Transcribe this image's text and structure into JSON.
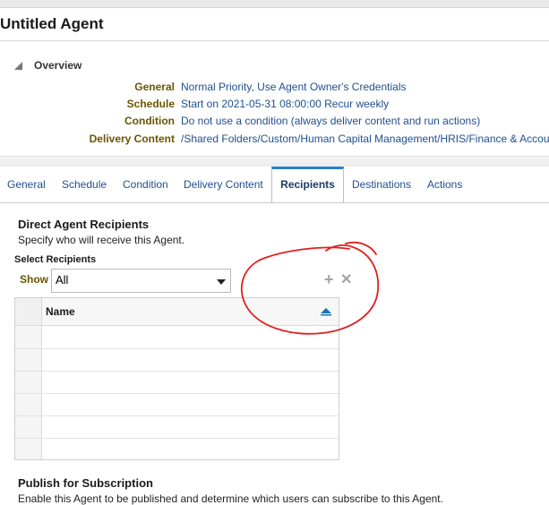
{
  "agent": {
    "title": "Untitled Agent"
  },
  "overview": {
    "heading": "Overview",
    "rows": [
      {
        "label": "General",
        "value": "Normal Priority, Use Agent Owner's Credentials"
      },
      {
        "label": "Schedule",
        "value": "Start on 2021-05-31 08:00:00 Recur weekly"
      },
      {
        "label": "Condition",
        "value": "Do not use a condition (always deliver content and run actions)"
      },
      {
        "label": "Delivery Content",
        "value": "/Shared Folders/Custom/Human Capital Management/HRIS/Finance & Accou"
      }
    ]
  },
  "tabs": [
    {
      "label": "General"
    },
    {
      "label": "Schedule"
    },
    {
      "label": "Condition"
    },
    {
      "label": "Delivery Content"
    },
    {
      "label": "Recipients"
    },
    {
      "label": "Destinations"
    },
    {
      "label": "Actions"
    }
  ],
  "recipients": {
    "title": "Direct Agent Recipients",
    "description": "Specify who will receive this Agent.",
    "select_label": "Select Recipients",
    "show_label": "Show",
    "show_value": "All",
    "add_icon_glyph": "+",
    "remove_icon_glyph": "✕",
    "table": {
      "column": "Name",
      "rows": [
        "",
        "",
        "",
        "",
        "",
        ""
      ]
    }
  },
  "publish": {
    "title": "Publish for Subscription",
    "description": "Enable this Agent to be published and determine which users can subscribe to this Agent."
  },
  "icons": {
    "overview_toggle": "triangle-expanded-icon",
    "add": "plus-icon",
    "remove": "close-icon",
    "sort": "sort-ascending-icon",
    "dropdown": "chevron-down-icon"
  },
  "colors": {
    "link": "#1f4f8f",
    "label_gold": "#6b5400",
    "active_tab_border": "#2a7fc9",
    "annotation_red": "#e02020",
    "sort_blue": "#1d6fb8"
  }
}
